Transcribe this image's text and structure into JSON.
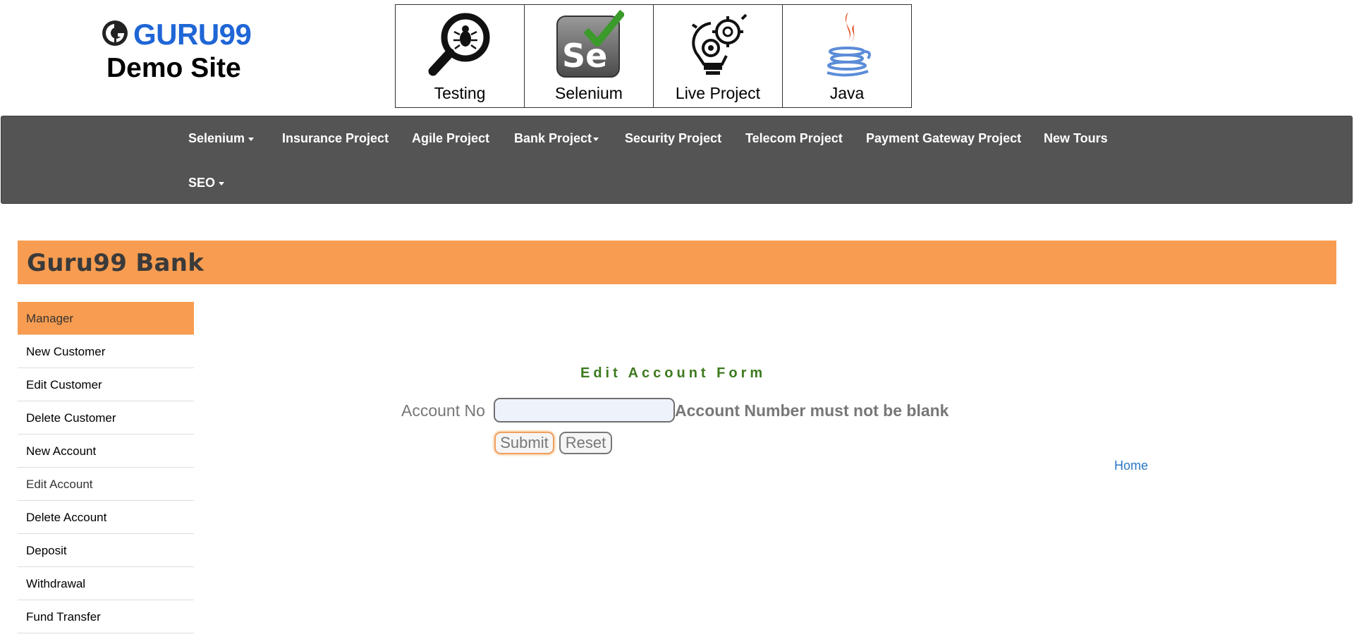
{
  "header": {
    "logo_text": "GURU99",
    "site_title": "Demo Site",
    "tiles": [
      {
        "label": "Testing",
        "icon": "magnifier-bug-icon"
      },
      {
        "label": "Selenium",
        "icon": "selenium-check-icon"
      },
      {
        "label": "Live Project",
        "icon": "lightbulb-gears-icon"
      },
      {
        "label": "Java",
        "icon": "java-cup-icon"
      }
    ]
  },
  "nav": {
    "items": [
      {
        "label": "Selenium",
        "dropdown": true
      },
      {
        "label": "Insurance Project",
        "dropdown": false
      },
      {
        "label": "Agile Project",
        "dropdown": false
      },
      {
        "label": "Bank Project",
        "dropdown": true
      },
      {
        "label": "Security Project",
        "dropdown": false
      },
      {
        "label": "Telecom Project",
        "dropdown": false
      },
      {
        "label": "Payment Gateway Project",
        "dropdown": false
      },
      {
        "label": "New Tours",
        "dropdown": false
      },
      {
        "label": "SEO",
        "dropdown": true
      }
    ]
  },
  "bank": {
    "title": "Guru99 Bank"
  },
  "sidebar": {
    "header": "Manager",
    "items": [
      {
        "label": "New Customer"
      },
      {
        "label": "Edit Customer"
      },
      {
        "label": "Delete Customer"
      },
      {
        "label": "New Account"
      },
      {
        "label": "Edit Account"
      },
      {
        "label": "Delete Account"
      },
      {
        "label": "Deposit"
      },
      {
        "label": "Withdrawal"
      },
      {
        "label": "Fund Transfer"
      }
    ]
  },
  "form": {
    "title": "Edit Account Form",
    "account_label": "Account No",
    "account_value": "",
    "error": "Account Number must not be blank",
    "submit_label": "Submit",
    "reset_label": "Reset",
    "home_link": "Home"
  },
  "colors": {
    "accent_orange": "#f79c50",
    "nav_bg": "#545454",
    "form_title_green": "#3d7a1f",
    "logo_blue": "#1f66d6",
    "link_blue": "#2a77c4"
  }
}
